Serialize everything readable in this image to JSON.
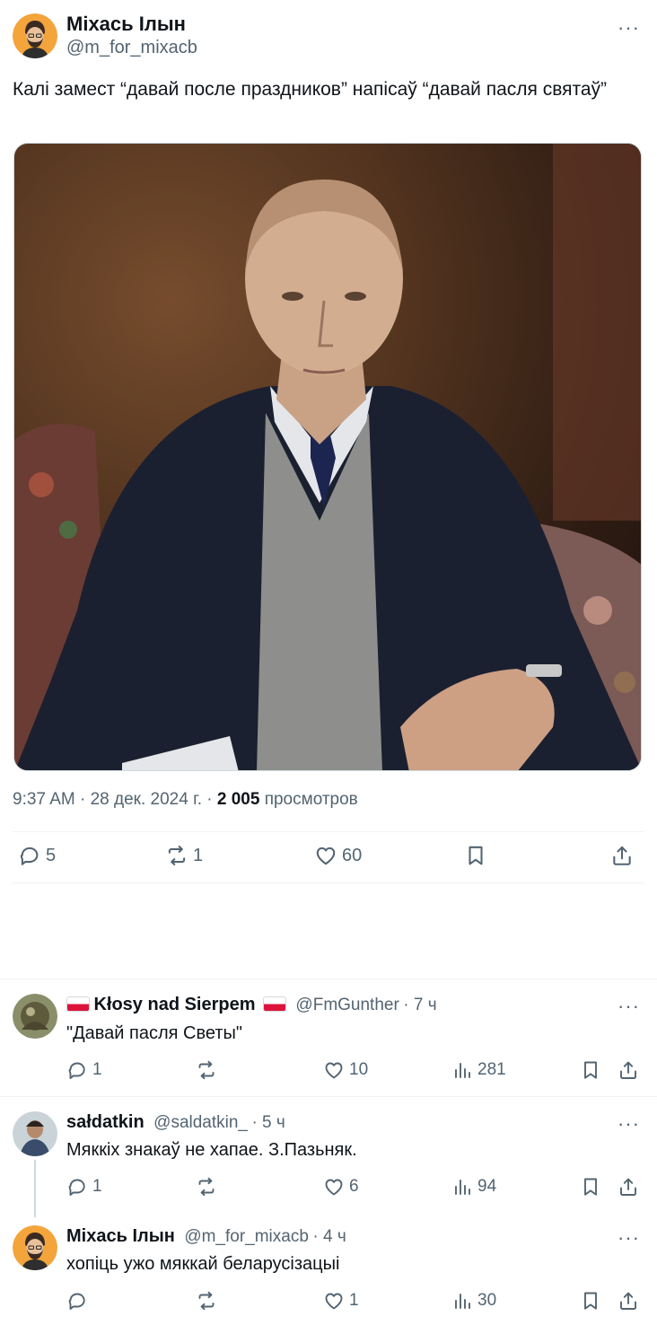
{
  "post": {
    "author_name": "Міхась Ілын",
    "author_handle": "@m_for_mixacb",
    "text": "Калі замест “давай после праздников” напісаў “давай пасля святаў”",
    "time": "9:37 AM",
    "date": "28 дек. 2024 г.",
    "views_count": "2 005",
    "views_label": "просмотров",
    "replies": "5",
    "reposts": "1",
    "likes": "60",
    "more": "···"
  },
  "replies": [
    {
      "name": "Kłosy nad Sierpem",
      "handle": "@FmGunther",
      "time": "· 7 ч",
      "text": "\"Давай пасля Светы\"",
      "replies": "1",
      "reposts": "",
      "likes": "10",
      "views": "281",
      "more": "···"
    },
    {
      "name": "sałdatkin",
      "handle": "@saldatkin_",
      "time": "· 5 ч",
      "text": "Мяккіх знакаў не хапае. З.Пазьняк.",
      "replies": "1",
      "reposts": "",
      "likes": "6",
      "views": "94",
      "more": "···"
    },
    {
      "name": "Міхась Ілын",
      "handle": "@m_for_mixacb",
      "time": "· 4 ч",
      "text": "хопіць ужо мяккай беларусізацыі",
      "replies": "",
      "reposts": "",
      "likes": "1",
      "views": "30",
      "more": "···"
    }
  ],
  "icons": {
    "reply": "reply-icon",
    "repost": "repost-icon",
    "like": "heart-icon",
    "bookmark": "bookmark-icon",
    "share": "share-icon",
    "views": "analytics-icon"
  },
  "colors": {
    "text": "#0f1419",
    "secondary": "#536471",
    "divider": "#eff3f4",
    "flag_red": "#dc143c"
  }
}
